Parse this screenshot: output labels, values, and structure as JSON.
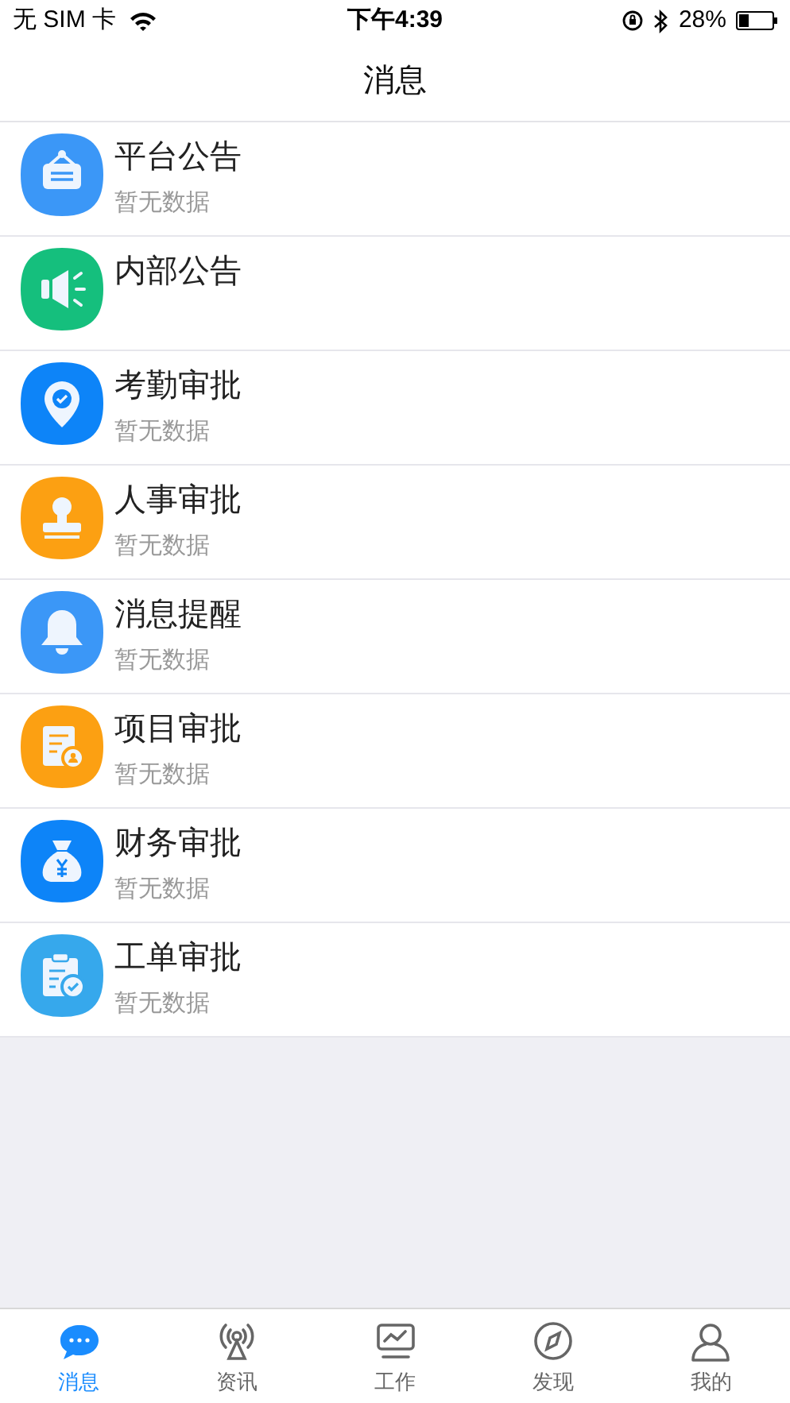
{
  "status_bar": {
    "carrier": "无 SIM 卡",
    "time": "下午4:39",
    "battery": "28%"
  },
  "header": {
    "title": "消息"
  },
  "messages": [
    {
      "kind": "signboard",
      "color": "#3b97f7",
      "title": "平台公告",
      "subtitle": "暂无数据"
    },
    {
      "kind": "speaker",
      "color": "#15bf7d",
      "title": "内部公告"
    },
    {
      "kind": "location",
      "color": "#0d84f8",
      "title": "考勤审批",
      "subtitle": "暂无数据"
    },
    {
      "kind": "stamp",
      "color": "#fca012",
      "title": "人事审批",
      "subtitle": "暂无数据"
    },
    {
      "kind": "bell",
      "color": "#3b97f7",
      "title": "消息提醒",
      "subtitle": "暂无数据"
    },
    {
      "kind": "document",
      "color": "#fca012",
      "title": "项目审批",
      "subtitle": "暂无数据"
    },
    {
      "kind": "moneybag",
      "color": "#0d84f8",
      "title": "财务审批",
      "subtitle": "暂无数据"
    },
    {
      "kind": "clipboard",
      "color": "#36a8ec",
      "title": "工单审批",
      "subtitle": "暂无数据"
    }
  ],
  "tabs": [
    {
      "kind": "chat",
      "label": "消息",
      "selected": true
    },
    {
      "kind": "antenna",
      "label": "资讯",
      "selected": false
    },
    {
      "kind": "monitor",
      "label": "工作",
      "selected": false
    },
    {
      "kind": "compass",
      "label": "发现",
      "selected": false
    },
    {
      "kind": "person",
      "label": "我的",
      "selected": false
    }
  ]
}
